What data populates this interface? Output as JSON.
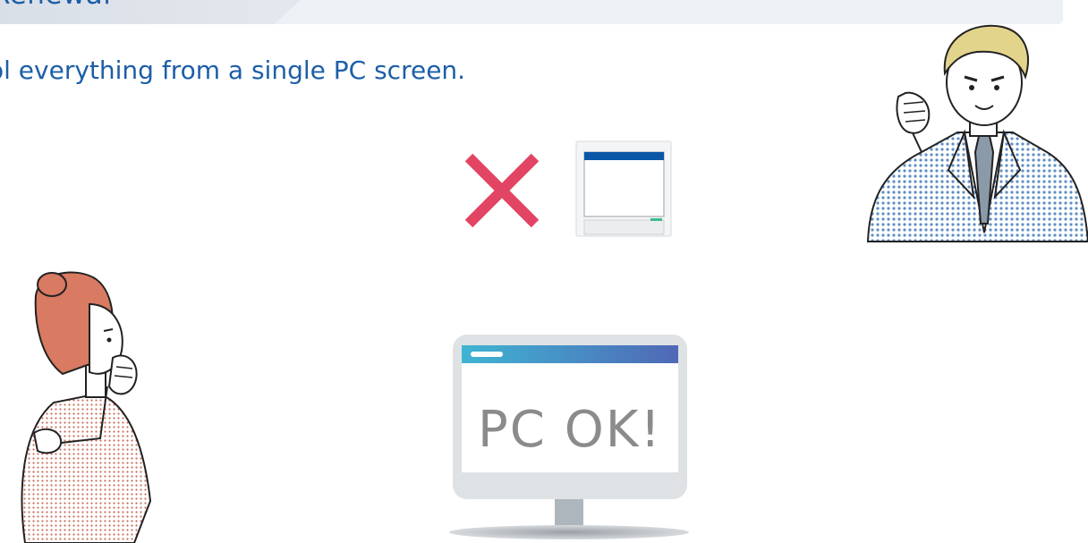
{
  "header": {
    "title": "Renewal"
  },
  "subtitle": "ol everything from a single PC screen.",
  "monitor": {
    "screen_text": "PC OK!"
  },
  "icons": {
    "cross": "x-mark-icon",
    "old_device": "device-screen-icon",
    "monitor": "pc-monitor-icon",
    "man": "businessman-illustration",
    "woman": "woman-thinking-illustration"
  },
  "colors": {
    "title_blue": "#1d5ea8",
    "cross_red": "#e24563",
    "screen_bar_start": "#3fb4d3",
    "screen_bar_end": "#5068b6",
    "suit_blue": "#6f9cc9",
    "hair_red": "#d97a62"
  }
}
